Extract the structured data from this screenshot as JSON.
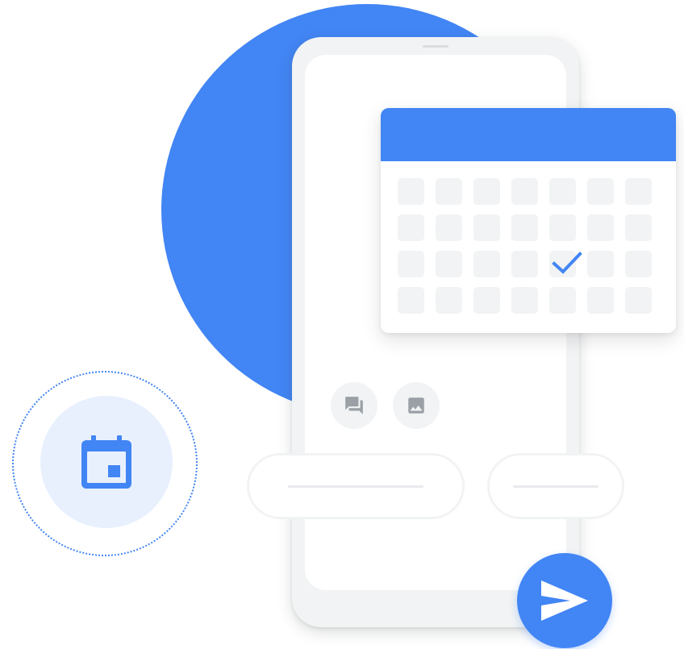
{
  "colors": {
    "accent": "#4285f4",
    "surface": "#f1f3f4",
    "badge_bg": "#e8f0fe",
    "icon_gray": "#9aa0a6"
  },
  "icons": {
    "chat": "forum-icon",
    "image": "image-icon",
    "calendar": "calendar-icon",
    "send": "send-icon",
    "check": "checkmark-icon"
  },
  "calendar": {
    "rows": 4,
    "columns": 7,
    "checked_day": {
      "row": 3,
      "column": 5
    }
  }
}
